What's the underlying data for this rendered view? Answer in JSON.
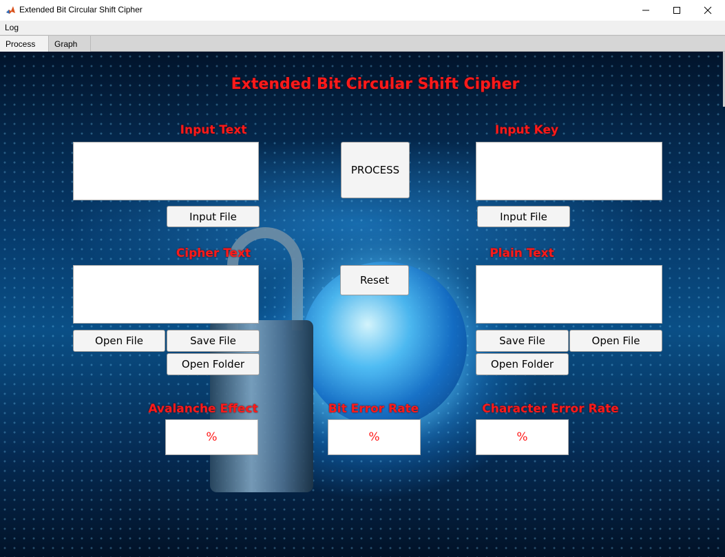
{
  "window": {
    "title": "Extended Bit Circular Shift Cipher"
  },
  "menu": {
    "log": "Log"
  },
  "tabs": [
    {
      "label": "Process"
    },
    {
      "label": "Graph"
    }
  ],
  "main": {
    "title": "Extended Bit Circular Shift Cipher",
    "input_text_label": "Input Text",
    "input_key_label": "Input Key",
    "cipher_text_label": "Cipher Text",
    "plain_text_label": "Plain Text",
    "process_button": "PROCESS",
    "reset_button": "Reset",
    "input_file_button": "Input File",
    "key_input_file_button": "Input File",
    "cipher_open_file_button": "Open File",
    "cipher_save_file_button": "Save File",
    "cipher_open_folder_button": "Open Folder",
    "plain_save_file_button": "Save File",
    "plain_open_file_button": "Open File",
    "plain_open_folder_button": "Open Folder",
    "avalanche_label": "Avalanche Effect",
    "ber_label": "Bit Error Rate",
    "cer_label": "Character Error Rate",
    "avalanche_value": "%",
    "ber_value": "%",
    "cer_value": "%"
  },
  "colors": {
    "accent": "#ff1a1a",
    "background": "#0a4f86"
  }
}
